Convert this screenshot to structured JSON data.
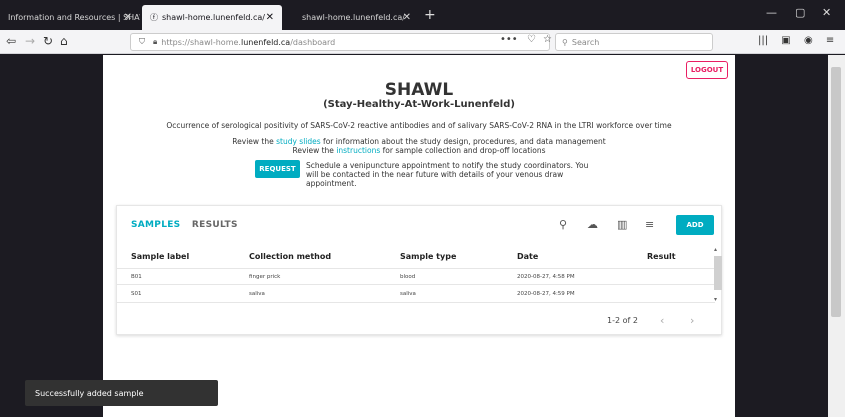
{
  "browser": {
    "tabs": [
      {
        "label": "Information and Resources | SHAW"
      },
      {
        "label": "shawl-home.lunenfeld.ca/"
      },
      {
        "label": "shawl-home.lunenfeld.ca/"
      }
    ],
    "url_prefix": "https://shawl-home.",
    "url_domain": "lunenfeld.ca",
    "url_path": "/dashboard",
    "search_placeholder": "Search",
    "window_controls": [
      "—",
      "▢",
      "✕"
    ]
  },
  "header": {
    "logout_label": "LOGOUT",
    "title": "SHAWL",
    "subtitle": "(Stay-Healthy-At-Work-Lunenfeld)",
    "description": "Occurrence of serological positivity of SARS-CoV-2 reactive antibodies and of salivary SARS-CoV-2 RNA in the LTRI workforce over time",
    "review_prefix": "Review the ",
    "study_slides_link": "study slides",
    "review_suffix": " for information about the study design, procedures, and data management",
    "review2_prefix": "Review the ",
    "instructions_link": "instructions",
    "review2_suffix": " for sample collection and drop-off locations",
    "request_label": "REQUEST",
    "request_text": "Schedule a venipuncture appointment to notify the study coordinators. You will be contacted in the near future with details of your venous draw appointment."
  },
  "table": {
    "tab_samples": "SAMPLES",
    "tab_results": "RESULTS",
    "add_label": "ADD",
    "columns": [
      "Sample label",
      "Collection method",
      "Sample type",
      "Date",
      "Result"
    ],
    "rows": [
      {
        "label": "B01",
        "method": "finger prick",
        "type": "blood",
        "date": "2020-08-27, 4:58 PM",
        "result": ""
      },
      {
        "label": "S01",
        "method": "saliva",
        "type": "saliva",
        "date": "2020-08-27, 4:59 PM",
        "result": ""
      }
    ],
    "pagination": "1-2 of 2"
  },
  "toast": {
    "message": "Successfully added sample"
  },
  "colors": {
    "accent": "#00acc1",
    "logout": "#e91e63"
  }
}
